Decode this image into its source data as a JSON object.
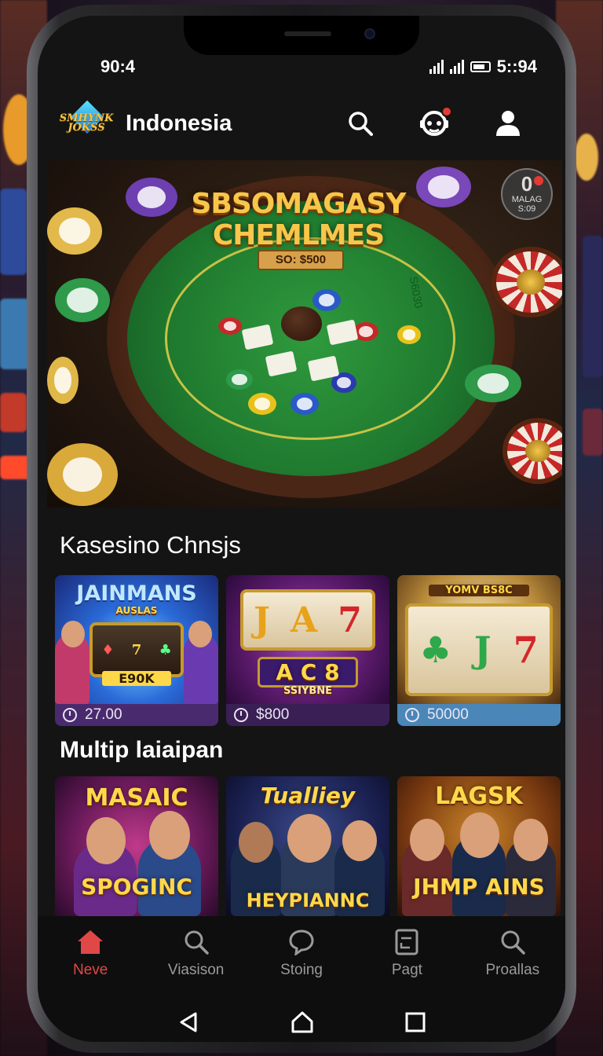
{
  "status": {
    "time": "90:4",
    "clock_right": "5::94"
  },
  "appbar": {
    "logo_text": "SMHYNK JOKSS",
    "title": "Indonesia",
    "icons": [
      "search-icon",
      "support-chat-icon",
      "profile-icon"
    ]
  },
  "hero": {
    "title": "SBSOMAGASY CHEMLMES",
    "subtitle": "SO: $500",
    "side_text": "S6030",
    "badge_number": "0",
    "badge_text": "MALAG",
    "badge_sub": "S:09"
  },
  "sections": [
    {
      "title": "Kasesino Chnsjs",
      "tiles": [
        {
          "caption": "JAINMANS",
          "sub": "AUSLAS",
          "screen": "E90K",
          "value": "27.00",
          "foot_color": "#4a2a6e"
        },
        {
          "caption": "J A 7",
          "sub": "SSIYBNE",
          "screen": "A C 8",
          "value": "$800",
          "foot_color": "#3a1f55"
        },
        {
          "caption": "♣ J 7",
          "sub": "YOMV BS8C",
          "screen": "",
          "value": "50000",
          "foot_color": "#4b86b8"
        }
      ]
    },
    {
      "title": "Multip laiaipan",
      "tiles": [
        {
          "caption": "MASAIC",
          "bottom_caption": "SPOGINC"
        },
        {
          "caption": "Tualliey",
          "bottom_caption": "HEYPIANNC"
        },
        {
          "caption": "LAGSK",
          "bottom_caption": "JHMP AINS"
        }
      ]
    }
  ],
  "bottom_nav": [
    {
      "label": "Neve",
      "icon": "home-icon",
      "active": true
    },
    {
      "label": "Viasison",
      "icon": "search-icon",
      "active": false
    },
    {
      "label": "Stoing",
      "icon": "chat-bubble-icon",
      "active": false
    },
    {
      "label": "Pagt",
      "icon": "page-icon",
      "active": false
    },
    {
      "label": "Proallas",
      "icon": "search-icon",
      "active": false
    }
  ],
  "colors": {
    "accent": "#e04848",
    "background": "#141414",
    "gold": "#f8c64a"
  }
}
